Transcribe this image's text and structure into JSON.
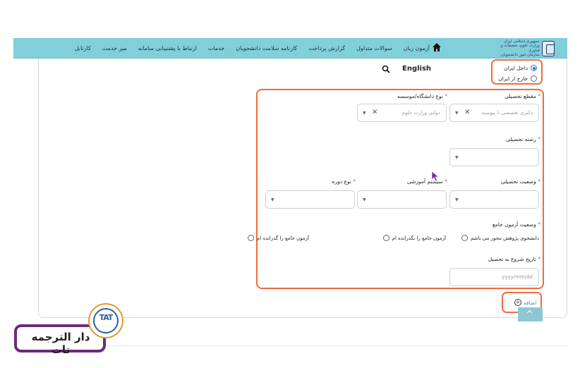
{
  "navbar": {
    "logo_text_1": "جمهوری اسلامی ایران",
    "logo_text_2": "وزارت علوم، تحقیقات و فناوری",
    "logo_text_3": "سازمان امور دانشجویان",
    "items": [
      "کارتابل",
      "میز خدمت",
      "ارتباط با پشتیبانی سامانه",
      "خدمات",
      "کارنامه سلامت دانشجویان",
      "گزارش پرداخت",
      "سوالات متداول",
      "آزمون زبان"
    ]
  },
  "header": {
    "language_link": "English"
  },
  "location_options": {
    "inside": "داخل ایران",
    "outside": "خارج از ایران",
    "selected": "inside"
  },
  "form": {
    "degree_label": "مقطع تحصیلی",
    "degree_value": "دکتری تخصصی نا پیوسته",
    "university_type_label": "نوع دانشگاه/موسسه",
    "university_type_value": "دولتی وزارت علوم",
    "field_label": "رشته تحصیلی",
    "status_label": "وضعیت تحصیلی",
    "system_label": "سیستم آموزشی",
    "period_label": "نوع دوره",
    "exam_label": "وضعیت آزمون جامع",
    "exam_options": [
      "دانشجوی پژوهش محور می باشم",
      "آزمون جامع را نگذرانده ام",
      "آزمون جامع را گذرانده ام"
    ],
    "start_date_label": "تاریخ شروع به تحصیل",
    "start_date_placeholder": "yyyy/mm/dd"
  },
  "add_button_label": "اضافه",
  "watermark": {
    "badge": "TAT",
    "text": "دار الترجمه تات"
  },
  "colors": {
    "navbar": "#82cfdc",
    "highlight": "#ef6b42",
    "radio": "#1f6fd1"
  }
}
